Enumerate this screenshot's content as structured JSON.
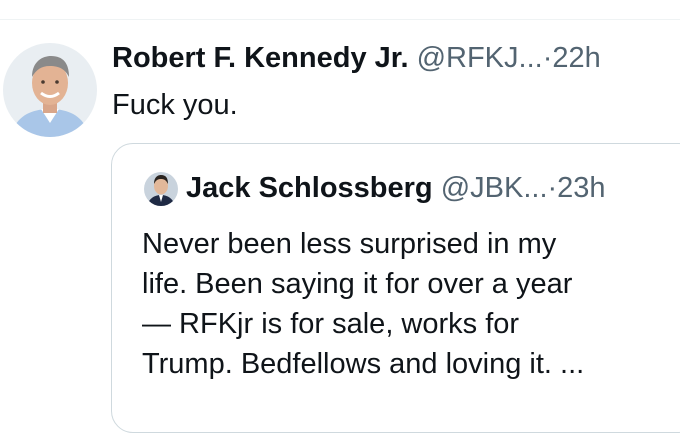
{
  "tweet": {
    "author": {
      "display_name": "Robert F. Kennedy Jr.",
      "handle": "@RFKJ...",
      "avatar_icon": "man-portrait-avatar"
    },
    "separator": "·",
    "time": "22h",
    "text": "Fuck you."
  },
  "quoted_tweet": {
    "author": {
      "display_name": "Jack Schlossberg",
      "handle": "@JBK...",
      "avatar_icon": "man-portrait-avatar"
    },
    "separator": "·",
    "time": "23h",
    "text_lines": [
      "Never been less surprised in my",
      "life. Been saying it for over a year",
      "— RFKjr is for sale, works for",
      "Trump. Bedfellows and loving it. ..."
    ]
  },
  "colors": {
    "text_primary": "#0f1419",
    "text_secondary": "#536471",
    "border": "#cfd9de"
  }
}
